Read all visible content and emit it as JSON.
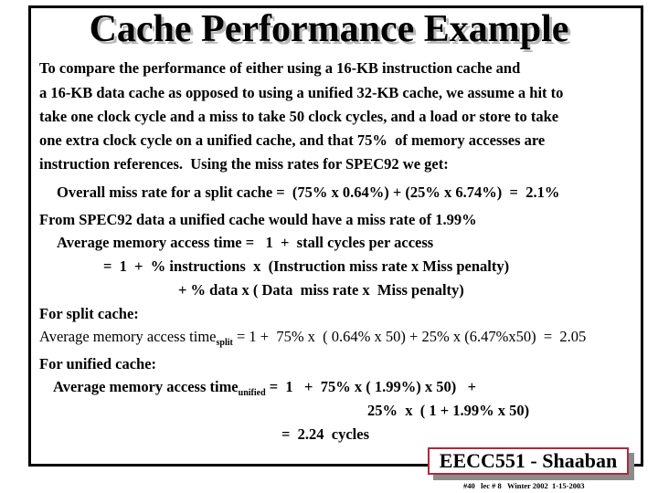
{
  "title": "Cache Performance Example",
  "intro": [
    "To compare the performance of either using a 16-KB instruction cache and",
    "a 16-KB data cache as opposed to using a unified 32-KB cache, we assume a hit to",
    "take one clock cycle and a miss to take 50 clock cycles, and a load or store to take",
    "one extra clock cycle on a unified cache, and that 75%  of memory accesses are",
    "instruction references.  Using the miss rates for SPEC92 we get:"
  ],
  "overall_miss_rate": "Overall miss rate for a split cache =  (75% x 0.64%) + (25% x 6.74%)  =  2.1%",
  "unified_miss_rate": "From SPEC92 data a unified cache would have a miss rate of 1.99%",
  "amat": [
    "Average memory access time =   1  +  stall cycles per access",
    "=  1  +  % instructions  x  (Instruction miss rate x Miss penalty)",
    "+ % data x ( Data  miss rate x  Miss penalty)"
  ],
  "split": {
    "heading": "For split cache:",
    "lhs": "Average memory access time",
    "subscript": "split",
    "rhs": " = 1 +  75% x  ( 0.64% x 50) + 25% x (6.47%x50)  =  2.05"
  },
  "unified": {
    "heading": "For unified cache:",
    "lhs": "Average memory access time",
    "subscript": "unified",
    "rhs1": " =  1   +  75% x ( 1.99%) x 50)   +",
    "rhs2": "25%  x  ( 1 + 1.99% x 50)",
    "result": "=  2.24  cycles"
  },
  "badge": "EECC551 - Shaaban",
  "footer": "#40   lec # 8   Winter 2002  1-15-2003"
}
